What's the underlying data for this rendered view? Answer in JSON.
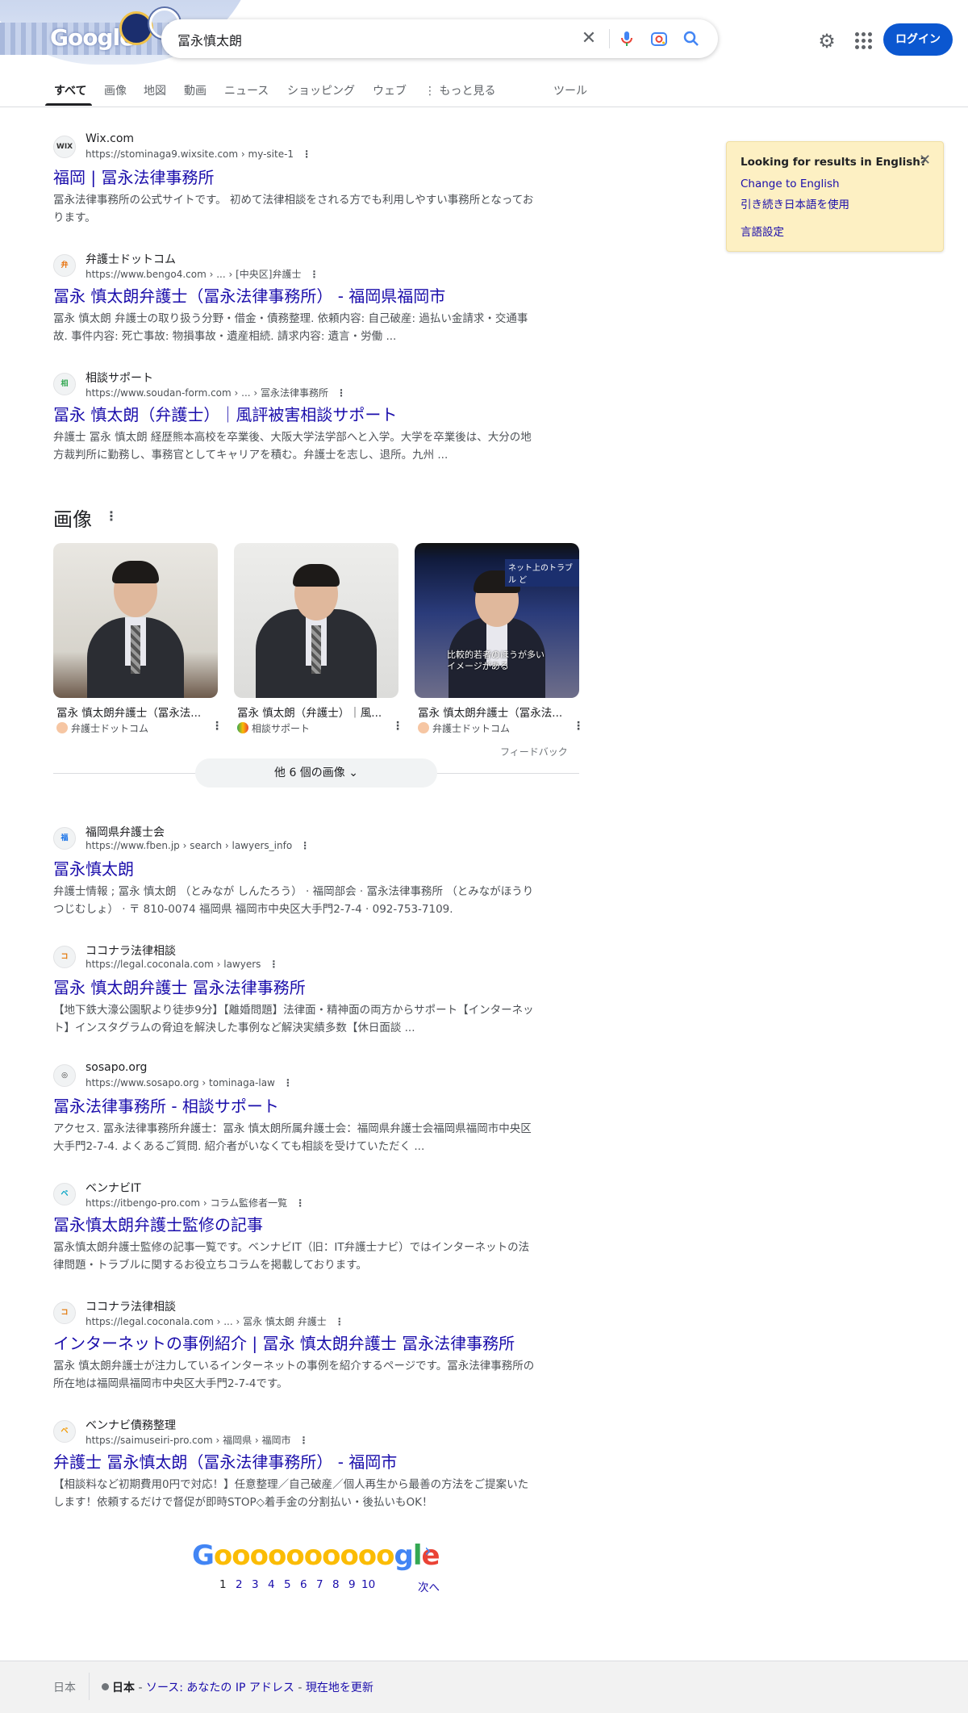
{
  "search": {
    "query": "冨永慎太朗",
    "clear_icon": "close-icon",
    "mic_icon": "mic-icon",
    "lens_icon": "lens-icon",
    "search_icon": "search-icon"
  },
  "header": {
    "login_label": "ログイン",
    "settings_icon": "gear-icon",
    "apps_icon": "apps-grid-icon",
    "logo_text": "Google"
  },
  "tabs": [
    "すべて",
    "画像",
    "地図",
    "動画",
    "ニュース",
    "ショッピング",
    "ウェブ",
    "もっと見る",
    "ツール"
  ],
  "results_top": [
    {
      "site": "Wix.com",
      "url": "https://stominaga9.wixsite.com › my-site-1",
      "title": "福岡 | 冨永法律事務所",
      "snippet": "冨永法律事務所の公式サイトです。 初めて法律相談をされる方でも利用しやすい事務所となっております。",
      "fav": "WIX"
    },
    {
      "site": "弁護士ドットコム",
      "url": "https://www.bengo4.com › ... › [中央区]弁護士",
      "title": "冨永 慎太朗弁護士（冨永法律事務所） - 福岡県福岡市",
      "snippet": "冨永 慎太朗 弁護士の取り扱う分野・借金・債務整理. 依頼内容: 自己破産: 過払い金請求・交通事故. 事件内容: 死亡事故: 物損事故・遺産相続. 請求内容: 遺言・労働 ...",
      "fav": "弁"
    },
    {
      "site": "相談サポート",
      "url": "https://www.soudan-form.com › ... › 冨永法律事務所",
      "title": "冨永 慎太朗（弁護士）｜風評被害相談サポート",
      "snippet": "弁護士 冨永 慎太朗 経歴熊本高校を卒業後、大阪大学法学部へと入学。大学を卒業後は、大分の地方裁判所に勤務し、事務官としてキャリアを積む。弁護士を志し、退所。九州 ...",
      "fav": "相"
    }
  ],
  "images": {
    "heading": "画像",
    "items": [
      {
        "caption": "冨永 慎太朗弁護士（冨永法...",
        "source": "弁護士ドットコム"
      },
      {
        "caption": "冨永 慎太朗（弁護士）｜風...",
        "source": "相談サポート"
      },
      {
        "caption": "冨永 慎太朗弁護士（冨永法...",
        "source": "弁護士ドットコム",
        "overlay_top": "ネット上のトラブル ど",
        "overlay_sub": "比較的若者のほうが多い イメージがある"
      }
    ],
    "feedback": "フィードバック",
    "more_label": "他 6 個の画像"
  },
  "results_bottom": [
    {
      "site": "福岡県弁護士会",
      "url": "https://www.fben.jp › search › lawyers_info",
      "title": "冨永慎太朗",
      "snippet": "弁護士情報 ; 冨永 慎太朗 （とみなが しんたろう） · 福岡部会 · 冨永法律事務所 （とみながほうりつじむしょ） · 〒 810-0074 福岡県 福岡市中央区大手門2-7-4 · 092-753-7109.",
      "fav": "福"
    },
    {
      "site": "ココナラ法律相談",
      "url": "https://legal.coconala.com › lawyers",
      "title": "冨永 慎太朗弁護士 冨永法律事務所",
      "snippet": "【地下鉄大濠公園駅より徒歩9分】【離婚問題】法律面・精神面の両方からサポート【インターネット】インスタグラムの脅迫を解決した事例など解決実績多数【休日面談 ...",
      "fav": "コ"
    },
    {
      "site": "sosapo.org",
      "url": "https://www.sosapo.org › tominaga-law",
      "title": "冨永法律事務所 - 相談サポート",
      "snippet": "アクセス. 冨永法律事務所弁護士：冨永 慎太朗所属弁護士会：福岡県弁護士会福岡県福岡市中央区大手門2-7-4. よくあるご質問. 紹介者がいなくても相談を受けていただく ...",
      "fav": "◎"
    },
    {
      "site": "ベンナビIT",
      "url": "https://itbengo-pro.com › コラム監修者一覧",
      "title": "冨永慎太朗弁護士監修の記事",
      "snippet": "冨永慎太朗弁護士監修の記事一覧です。ベンナビIT（旧：IT弁護士ナビ）ではインターネットの法律問題・トラブルに関するお役立ちコラムを掲載しております。",
      "fav": "ベ"
    },
    {
      "site": "ココナラ法律相談",
      "url": "https://legal.coconala.com › ... › 冨永 慎太朗 弁護士",
      "title": "インターネットの事例紹介 | 冨永 慎太朗弁護士 冨永法律事務所",
      "snippet": "冨永 慎太朗弁護士が注力しているインターネットの事例を紹介するページです。冨永法律事務所の所在地は福岡県福岡市中央区大手門2-7-4です。",
      "fav": "コ"
    },
    {
      "site": "ベンナビ債務整理",
      "url": "https://saimuseiri-pro.com › 福岡県 › 福岡市",
      "title": "弁護士 冨永慎太朗（冨永法律事務所） - 福岡市",
      "snippet": "【相談料など初期費用0円で対応！】任意整理／自己破産／個人再生から最善の方法をご提案いたします！依頼するだけで督促が即時STOP◇着手金の分割払い・後払いもOK！",
      "fav": "ベ"
    }
  ],
  "lang_card": {
    "question": "Looking for results in English?",
    "link1": "Change to English",
    "link2": "引き続き日本語を使用",
    "link3": "言語設定"
  },
  "pager": {
    "logo": "Goooooooooogle",
    "pages": [
      "1",
      "2",
      "3",
      "4",
      "5",
      "6",
      "7",
      "8",
      "9",
      "10"
    ],
    "next": "次へ"
  },
  "footer": {
    "country": "日本",
    "location": "日本",
    "source": "ソース: あなたの IP アドレス",
    "update": "現在地を更新"
  },
  "colors": {
    "link": "#1a0dab",
    "login": "#0b57d0",
    "card": "#fdf0c3"
  }
}
